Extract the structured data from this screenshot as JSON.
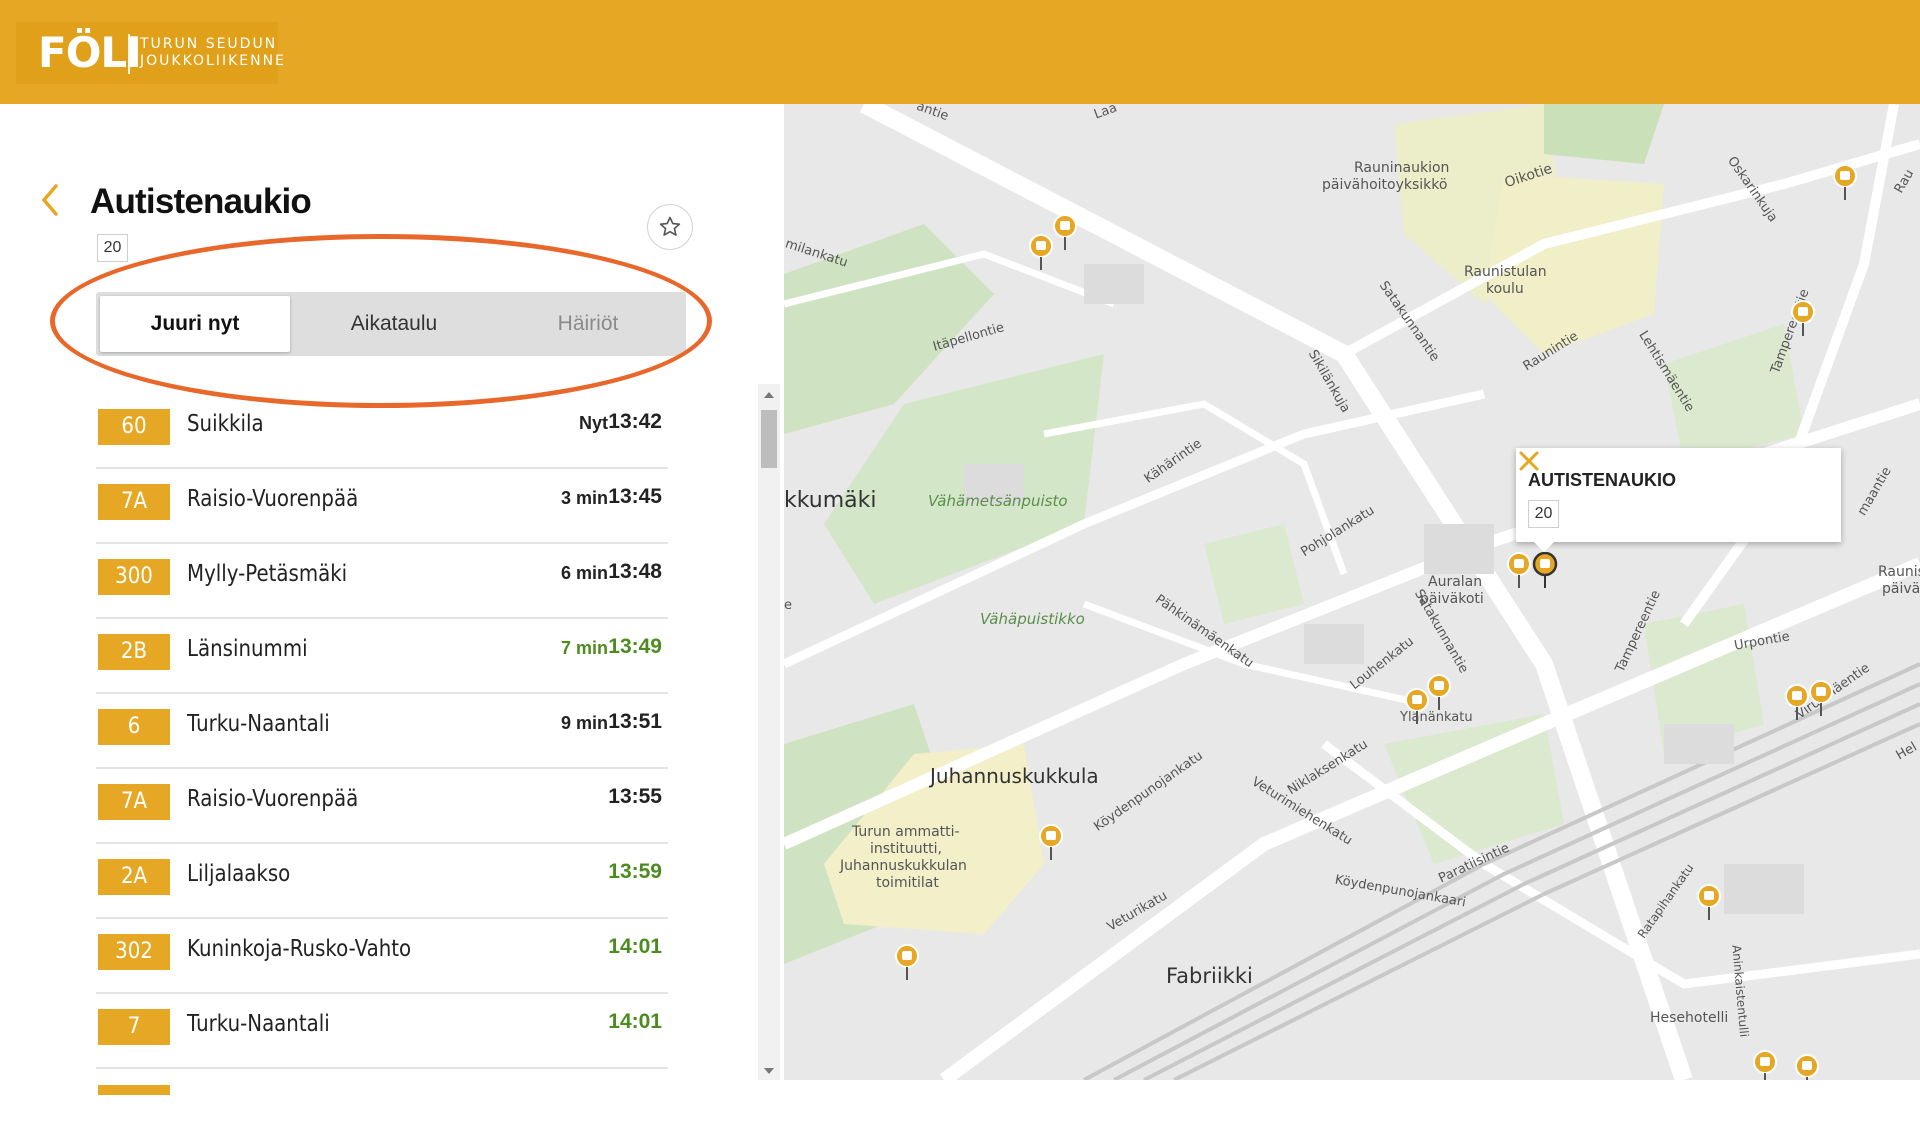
{
  "header": {
    "logo_text": "FÖLI",
    "logo_sub_line1": "TURUN SEUDUN",
    "logo_sub_line2": "JOUKKOLIIKENNE",
    "brand_color": "#e6a724"
  },
  "stop": {
    "name": "Autistenaukio",
    "number": "20"
  },
  "tabs": [
    {
      "label": "Juuri nyt",
      "active": true
    },
    {
      "label": "Aikataulu",
      "active": false
    },
    {
      "label": "Häiriöt",
      "active": false
    }
  ],
  "departures": [
    {
      "line": "60",
      "destination": "Suikkila",
      "in": "Nyt",
      "time": "13:42",
      "realtime": false
    },
    {
      "line": "7A",
      "destination": "Raisio-Vuorenpää",
      "in": "3 min",
      "time": "13:45",
      "realtime": false
    },
    {
      "line": "300",
      "destination": "Mylly-Petäsmäki",
      "in": "6 min",
      "time": "13:48",
      "realtime": false
    },
    {
      "line": "2B",
      "destination": "Länsinummi",
      "in": "7 min",
      "time": "13:49",
      "realtime": true
    },
    {
      "line": "6",
      "destination": "Turku-Naantali",
      "in": "9 min",
      "time": "13:51",
      "realtime": false
    },
    {
      "line": "7A",
      "destination": "Raisio-Vuorenpää",
      "in": "",
      "time": "13:55",
      "realtime": false
    },
    {
      "line": "2A",
      "destination": "Liljalaakso",
      "in": "",
      "time": "13:59",
      "realtime": true
    },
    {
      "line": "302",
      "destination": "Kuninkoja-Rusko-Vahto",
      "in": "",
      "time": "14:01",
      "realtime": true
    },
    {
      "line": "7",
      "destination": "Turku-Naantali",
      "in": "",
      "time": "14:01",
      "realtime": true
    }
  ],
  "map": {
    "popup": {
      "title": "AUTISTENAUKIO",
      "number": "20"
    },
    "labels": {
      "l1": "Rauninaukion",
      "l2": "päivähoitoyksikkö",
      "l3": "Oikotie",
      "l4": "Raunistulan",
      "l5": "koulu",
      "l6": "Itäpellontie",
      "l7": "Satakunnantie",
      "l8": "Sikilänkuja",
      "l9": "kkumäki",
      "l10": "Vähämetsänpuisto",
      "l11": "Kähärintie",
      "l12": "Pohjolankatu",
      "l13": "Auralan",
      "l14": "päiväkoti",
      "l15": "Vähäpuistikko",
      "l16": "Pähkinämäenkatu",
      "l17": "Juhannuskukkula",
      "l18": "Turun ammatti-",
      "l19": "instituutti,",
      "l20": "Juhannuskukkulan",
      "l21": "toimitilat",
      "l22": "Köydenpunojankatu",
      "l23": "Veturimiehenkatu",
      "l24": "Fabriikki",
      "l25": "Veturikatu",
      "l26": "Ylänänkatu",
      "l27": "Niklaksenkatu",
      "l28": "Urpontie",
      "l29": "Raunintie",
      "l30": "Tampereentie",
      "l31": "Hesehotelli",
      "l32": "Aninkaistentulli",
      "l33": "Ratapihankatu",
      "l34": "Köydenpunojankaari",
      "l35": "Paratiisintie",
      "l36": "Louhenkatu",
      "l37": "Lehtismäentie",
      "l38": "Oskarinkuja",
      "l39": "Virusmäentie",
      "l40": "milankatu",
      "l41": "antie",
      "l42": "Raunis",
      "l43": "päivä",
      "l44": "Laa",
      "l45": "Satakunnantie",
      "l46": "Tampereentie",
      "l47": "maantie",
      "l48": "Rau",
      "l49": "Hel",
      "l50": "e"
    }
  }
}
